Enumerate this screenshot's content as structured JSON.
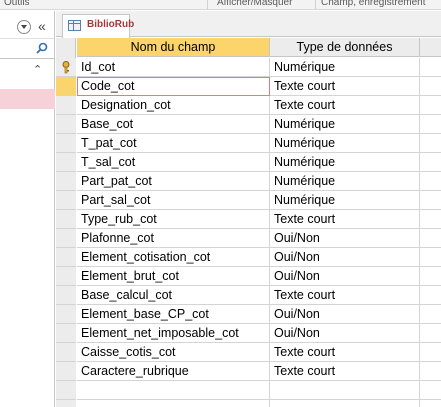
{
  "ribbon": {
    "group_outils": "Outils",
    "group_afficher": "Afficher/Masquer",
    "group_champ": "Champ, enregistrement"
  },
  "nav_pane": {
    "icons": [
      "chevron-down-icon",
      "collapse-pane-icon",
      "search-icon",
      "chevron-up-icon"
    ]
  },
  "tab": {
    "title": "BiblioRub",
    "icon": "table-icon"
  },
  "grid": {
    "columns": [
      "Nom du champ",
      "Type de données",
      ""
    ],
    "current_row": 1,
    "primary_key_row": 0,
    "rows": [
      {
        "name": "Id_cot",
        "type": "Numérique"
      },
      {
        "name": "Code_cot",
        "type": "Texte court"
      },
      {
        "name": "Designation_cot",
        "type": "Texte court"
      },
      {
        "name": "Base_cot",
        "type": "Numérique"
      },
      {
        "name": "T_pat_cot",
        "type": "Numérique"
      },
      {
        "name": "T_sal_cot",
        "type": "Numérique"
      },
      {
        "name": "Part_pat_cot",
        "type": "Numérique"
      },
      {
        "name": "Part_sal_cot",
        "type": "Numérique"
      },
      {
        "name": "Type_rub_cot",
        "type": "Texte court"
      },
      {
        "name": "Plafonne_cot",
        "type": "Oui/Non"
      },
      {
        "name": "Element_cotisation_cot",
        "type": "Oui/Non"
      },
      {
        "name": "Element_brut_cot",
        "type": "Oui/Non"
      },
      {
        "name": "Base_calcul_cot",
        "type": "Texte court"
      },
      {
        "name": "Element_base_CP_cot",
        "type": "Oui/Non"
      },
      {
        "name": "Element_net_imposable_cot",
        "type": "Oui/Non"
      },
      {
        "name": "Caisse_cotis_cot",
        "type": "Texte court"
      },
      {
        "name": "Caractere_rubrique",
        "type": "Texte court"
      },
      {
        "name": "",
        "type": ""
      },
      {
        "name": "",
        "type": ""
      }
    ]
  },
  "colors": {
    "accent_header": "#fbd56c",
    "tab_title": "#a4373a",
    "current_cell_border": "#e27b83",
    "nav_selection": "#f6d2d8"
  }
}
